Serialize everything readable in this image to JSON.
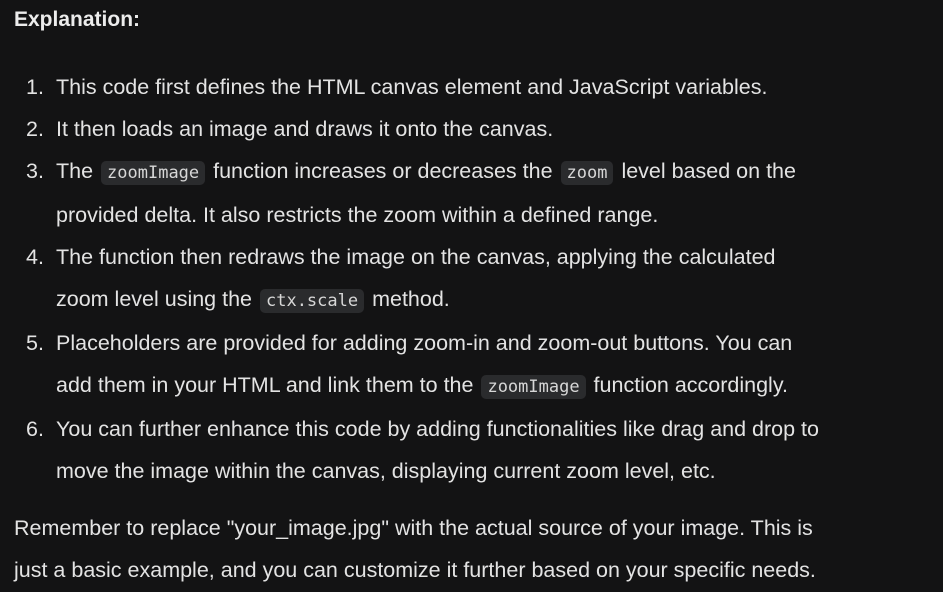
{
  "heading": "Explanation:",
  "steps": [
    {
      "num": "1.",
      "lines": [
        [
          "This code first defines the HTML canvas element and JavaScript variables."
        ]
      ]
    },
    {
      "num": "2.",
      "lines": [
        [
          "It then loads an image and draws it onto the canvas."
        ]
      ]
    },
    {
      "num": "3.",
      "lines": [
        [
          "The ",
          {
            "code": "zoomImage"
          },
          " function increases or decreases the ",
          {
            "code": "zoom"
          },
          " level based on the"
        ],
        [
          "provided delta. It also restricts the zoom within a defined range."
        ]
      ]
    },
    {
      "num": "4.",
      "lines": [
        [
          "The function then redraws the image on the canvas, applying the calculated"
        ],
        [
          "zoom level using the ",
          {
            "code": "ctx.scale"
          },
          " method."
        ]
      ]
    },
    {
      "num": "5.",
      "lines": [
        [
          "Placeholders are provided for adding zoom-in and zoom-out buttons. You can"
        ],
        [
          "add them in your HTML and link them to the ",
          {
            "code": "zoomImage"
          },
          " function accordingly."
        ]
      ]
    },
    {
      "num": "6.",
      "lines": [
        [
          "You can further enhance this code by adding functionalities like drag and drop to"
        ],
        [
          "move the image within the canvas, displaying current zoom level, etc."
        ]
      ]
    }
  ],
  "closing": [
    "Remember to replace \"your_image.jpg\" with the actual source of your image. This is",
    "just a basic example, and you can customize it further based on your specific needs."
  ]
}
